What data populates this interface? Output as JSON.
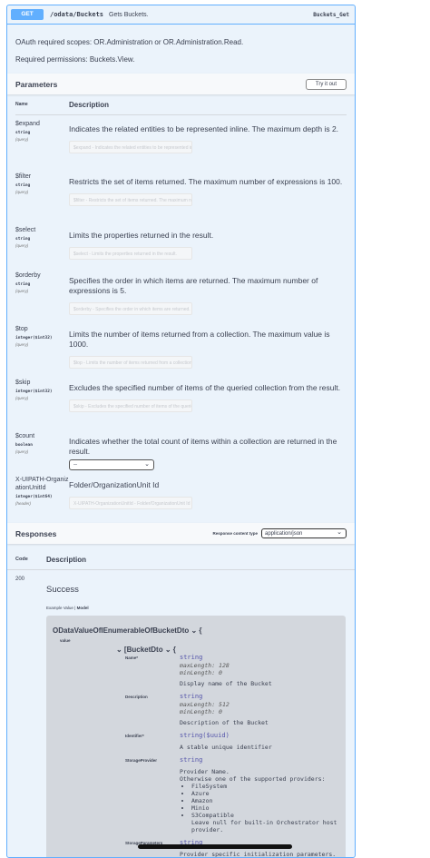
{
  "summary": {
    "method": "GET",
    "path": "/odata/Buckets",
    "description": "Gets Buckets.",
    "operation_id": "Buckets_Get"
  },
  "op_description": {
    "scopes": "OAuth required scopes: OR.Administration or OR.Administration.Read.",
    "permissions": "Required permissions: Buckets.View."
  },
  "parameters": {
    "title": "Parameters",
    "try_it_out": "Try it out",
    "col_name": "Name",
    "col_description": "Description",
    "items": [
      {
        "name": "$expand",
        "type": "string",
        "in": "(query)",
        "description": "Indicates the related entities to be represented inline. The maximum depth is 2.",
        "placeholder": "$expand - Indicates the related entities to be represented inline. The maximum depth is 2."
      },
      {
        "name": "$filter",
        "type": "string",
        "in": "(query)",
        "description": "Restricts the set of items returned. The maximum number of expressions is 100.",
        "placeholder": "$filter - Restricts the set of items returned. The maximum number of expressions is 100."
      },
      {
        "name": "$select",
        "type": "string",
        "in": "(query)",
        "description": "Limits the properties returned in the result.",
        "placeholder": "$select - Limits the properties returned in the result."
      },
      {
        "name": "$orderby",
        "type": "string",
        "in": "(query)",
        "description": "Specifies the order in which items are returned. The maximum number of expressions is 5.",
        "placeholder": "$orderby - Specifies the order in which items are returned. The maximum number of expressions is 5."
      },
      {
        "name": "$top",
        "type": "integer($int32)",
        "in": "(query)",
        "description": "Limits the number of items returned from a collection. The maximum value is 1000.",
        "placeholder": "$top - Limits the number of items returned from a collection. The maximum value is 1000."
      },
      {
        "name": "$skip",
        "type": "integer($int32)",
        "in": "(query)",
        "description": "Excludes the specified number of items of the queried collection from the result.",
        "placeholder": "$skip - Excludes the specified number of items of the queried collection from the result."
      },
      {
        "name": "$count",
        "type": "boolean",
        "in": "(query)",
        "description": "Indicates whether the total count of items within a collection are returned in the result.",
        "select_value": "--"
      },
      {
        "name": "X-UIPATH-OrganizationUnitId",
        "type": "integer($int64)",
        "in": "(header)",
        "description": "Folder/OrganizationUnit Id",
        "placeholder": "X-UIPATH-OrganizationUnitId - Folder/OrganizationUnit Id"
      }
    ]
  },
  "responses": {
    "title": "Responses",
    "content_type_label": "Response content type",
    "content_type_value": "application/json",
    "col_code": "Code",
    "col_description": "Description",
    "code": "200",
    "description": "Success",
    "tab_example": "Example Value",
    "tab_sep": "|",
    "tab_model": "Model",
    "model": {
      "title": "ODataValueOfIEnumerableOfBucketDto",
      "value_label": "value",
      "inner_title": "BucketDto",
      "fields": [
        {
          "name": "Name*",
          "type": "string",
          "meta": [
            "maxLength: 128",
            "minLength: 0"
          ],
          "desc": "Display name of the Bucket"
        },
        {
          "name": "Description",
          "type": "string",
          "meta": [
            "maxLength: 512",
            "minLength: 0"
          ],
          "desc": "Description of the Bucket"
        },
        {
          "name": "Identifier*",
          "type": "string($uuid)",
          "meta": [],
          "desc": "A stable unique identifier"
        },
        {
          "name": "StorageProvider",
          "type": "string",
          "meta": [],
          "desc": "Provider Name.\nOtherwise one of the supported providers:",
          "list": [
            "FileSystem",
            "Azure",
            "Amazon",
            "Minio",
            "S3Compatible"
          ],
          "after": "Leave null for built-in Orchestrator host provider."
        },
        {
          "name": "StorageParameters",
          "type": "string",
          "meta": [],
          "desc": "Provider specific initialization parameters.\nUse a $Password for where the password should be inserted."
        }
      ]
    }
  }
}
